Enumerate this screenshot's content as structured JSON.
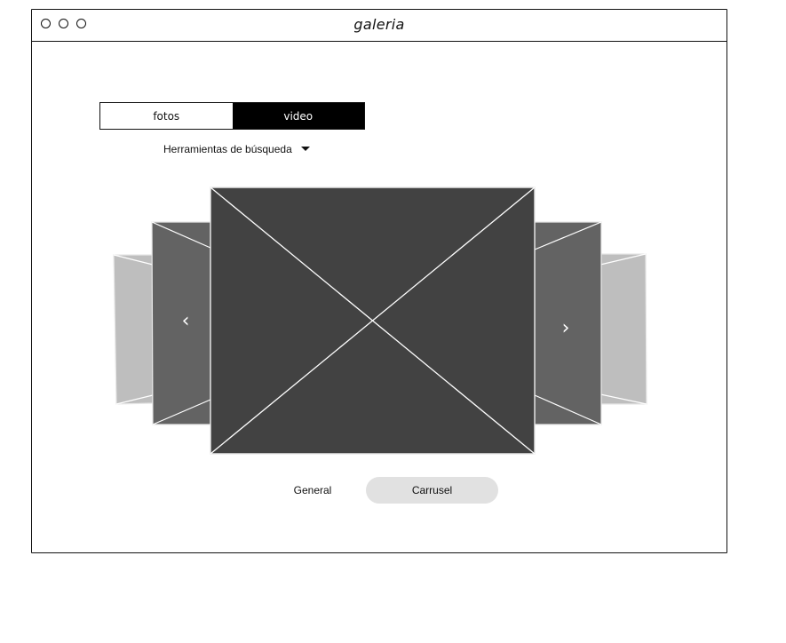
{
  "window": {
    "title": "galeria"
  },
  "tabs": [
    {
      "label": "fotos",
      "active": false
    },
    {
      "label": "video",
      "active": true
    }
  ],
  "search_tools": {
    "label": "Herramientas de búsqueda"
  },
  "carousel": {
    "prev_arrow": "‹",
    "next_arrow": "›"
  },
  "view_switch": {
    "general_label": "General",
    "carousel_label": "Carrusel",
    "selected": "Carrusel"
  },
  "colors": {
    "main_image": "#424242",
    "side_image": "#636363",
    "far_image": "#bebebe",
    "selected_pill": "#e1e1e1",
    "active_tab": "#000000"
  }
}
